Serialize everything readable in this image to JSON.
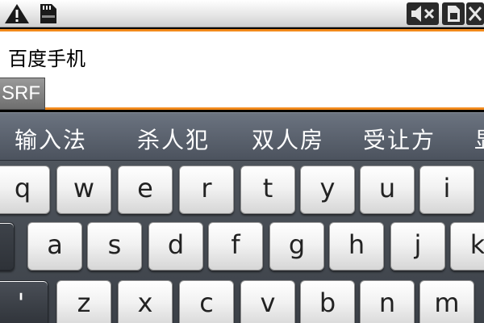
{
  "status_bar": {
    "icons": [
      "warning-icon",
      "sd-card-icon",
      "mute-icon",
      "sim-card-icon",
      "no-signal-icon"
    ]
  },
  "input": {
    "value": "百度手机",
    "ime_label": "SRF",
    "accent_color": "#f28a1c"
  },
  "candidates": [
    "输入法",
    "杀人犯",
    "双人房",
    "受让方",
    "显"
  ],
  "keyboard": {
    "row1": [
      "q",
      "w",
      "e",
      "r",
      "t",
      "y",
      "u",
      "i"
    ],
    "row2": [
      "a",
      "s",
      "d",
      "f",
      "g",
      "h",
      "j",
      "k"
    ],
    "row3_first": "'",
    "row3": [
      "z",
      "x",
      "c",
      "v",
      "b",
      "n",
      "m"
    ]
  }
}
